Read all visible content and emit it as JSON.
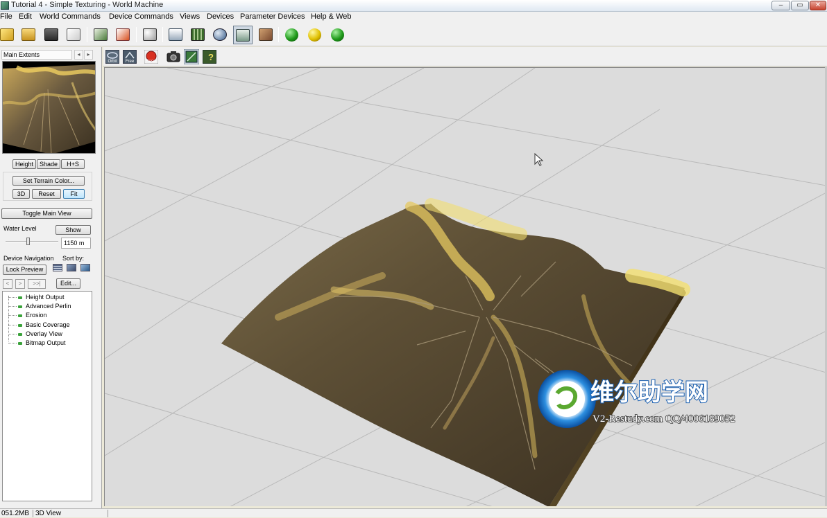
{
  "window": {
    "title": "Tutorial 4 - Simple Texturing - World Machine"
  },
  "menu": [
    "File",
    "Edit",
    "World Commands",
    "Device Commands",
    "Views",
    "Devices",
    "Parameter Devices",
    "Help & Web"
  ],
  "toolbar": {
    "icons": [
      "new-world-icon",
      "open-icon",
      "save-icon",
      "import-icon",
      "layout-view-icon",
      "notes-icon",
      "random-seed-icon",
      "device-view-icon",
      "grid-view-icon",
      "3d-view-icon",
      "explorer-view-icon",
      "texture-view-icon",
      "build-icon",
      "build-preview-icon",
      "build-options-icon"
    ],
    "active": "explorer-view-icon"
  },
  "view_toolbar": {
    "labels": [
      "Orbit",
      "Free",
      "Reset"
    ]
  },
  "left_panel": {
    "preview_title": "Main Extents",
    "preview_buttons": [
      "Height",
      "Shade",
      "H+S"
    ],
    "set_terrain_color": "Set Terrain Color...",
    "view_buttons": [
      "3D",
      "Reset",
      "Fit"
    ],
    "toggle_main_view": "Toggle Main View",
    "water_level_label": "Water Level",
    "water_show": "Show",
    "water_value": "1150 m",
    "water_level_fraction": 0.42,
    "device_navigation_label": "Device Navigation",
    "sort_by_label": "Sort by:",
    "lock_preview": "Lock Preview",
    "nav_buttons": [
      "<",
      ">",
      ">>|"
    ],
    "edit": "Edit...",
    "devices": [
      "Height Output",
      "Advanced Perlin",
      "Erosion",
      "Basic Coverage",
      "Overlay View",
      "Bitmap Output"
    ]
  },
  "watermark": {
    "cn": "维尔助学网",
    "en": "V2-Restudy.com QQ/4006189052"
  },
  "status": {
    "memory": "051.2MB",
    "view": "3D View"
  }
}
